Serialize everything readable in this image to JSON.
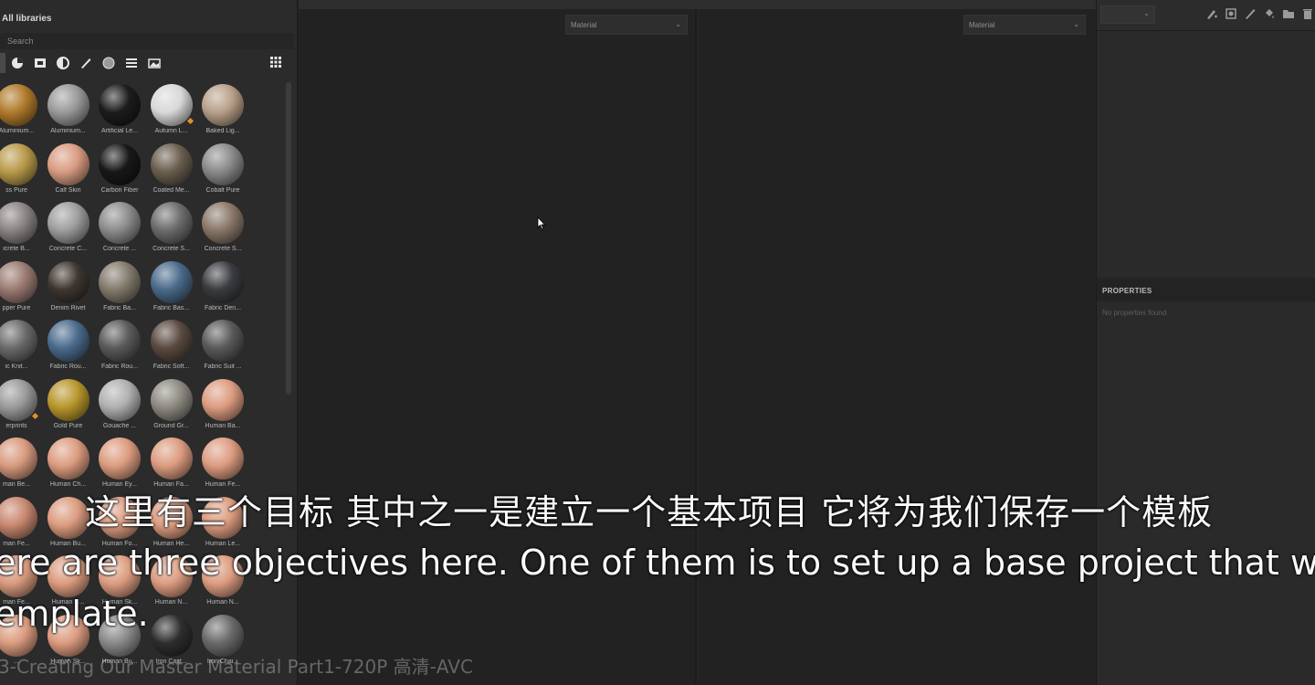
{
  "library": {
    "title": "All libraries",
    "search_placeholder": "Search",
    "filter_icons": [
      "all-filter",
      "material-filter",
      "square-filter",
      "smart-filter",
      "brush-filter",
      "texture-filter",
      "pattern-filter",
      "scene-filter"
    ],
    "rows": [
      [
        {
          "label": "Aluminium...",
          "color": "#b07a2c"
        },
        {
          "label": "Aluminium...",
          "color": "#9a9a9a"
        },
        {
          "label": "Artificial Le...",
          "color": "#1c1c1c"
        },
        {
          "label": "Autumn L...",
          "color": "#d8d8d8",
          "badge": true
        },
        {
          "label": "Baked Lig...",
          "color": "#b8a08a"
        }
      ],
      [
        {
          "label": "ss Pure",
          "color": "#b89a4a"
        },
        {
          "label": "Calf Skin",
          "color": "#d89c82"
        },
        {
          "label": "Carbon Fiber",
          "color": "#181818"
        },
        {
          "label": "Coated Me...",
          "color": "#6a5e4e"
        },
        {
          "label": "Cobalt Pure",
          "color": "#8a8a8a"
        }
      ],
      [
        {
          "label": "icrete B...",
          "color": "#8a8482"
        },
        {
          "label": "Concrete C...",
          "color": "#9e9e9e"
        },
        {
          "label": "Concrete ...",
          "color": "#8c8c8c"
        },
        {
          "label": "Concrete S...",
          "color": "#6c6c6c"
        },
        {
          "label": "Concrete S...",
          "color": "#8a786a"
        }
      ],
      [
        {
          "label": "pper Pure",
          "color": "#9a7a72"
        },
        {
          "label": "Denim Rivet",
          "color": "#3e3630"
        },
        {
          "label": "Fabric Ba...",
          "color": "#827a6c"
        },
        {
          "label": "Fabric Bas...",
          "color": "#4a6a8a"
        },
        {
          "label": "Fabric Den...",
          "color": "#3a3c40"
        }
      ],
      [
        {
          "label": "ic Knit...",
          "color": "#6a6a6a"
        },
        {
          "label": "Fabric Rou...",
          "color": "#4a6a8c"
        },
        {
          "label": "Fabric Rou...",
          "color": "#5a5a5a"
        },
        {
          "label": "Fabric Soft...",
          "color": "#5a4a40"
        },
        {
          "label": "Fabric Suit ...",
          "color": "#5a5a5a"
        }
      ],
      [
        {
          "label": "erprints",
          "color": "#9a9a9a",
          "badge": true
        },
        {
          "label": "Gold Pure",
          "color": "#b8962c"
        },
        {
          "label": "Gouache ...",
          "color": "#b0b0b0"
        },
        {
          "label": "Ground Gr...",
          "color": "#8e8a82"
        },
        {
          "label": "Human Ba...",
          "color": "#dc9c80"
        }
      ],
      [
        {
          "label": "man Be...",
          "color": "#d89a7e"
        },
        {
          "label": "Human Ch...",
          "color": "#dc9c80"
        },
        {
          "label": "Human Ey...",
          "color": "#dc9c80"
        },
        {
          "label": "Human Fa...",
          "color": "#dc9c80"
        },
        {
          "label": "Human Fe...",
          "color": "#dc9c80"
        }
      ],
      [
        {
          "label": "man Fe...",
          "color": "#c88870"
        },
        {
          "label": "Human Bu...",
          "color": "#dc9c80"
        },
        {
          "label": "Human Fo...",
          "color": "#dc9c80"
        },
        {
          "label": "Human He...",
          "color": "#dc9c80"
        },
        {
          "label": "Human Le...",
          "color": "#dc9c80"
        }
      ],
      [
        {
          "label": "man Fe...",
          "color": "#d89a7e"
        },
        {
          "label": "Human N...",
          "color": "#dc9c80"
        },
        {
          "label": "Human Sk...",
          "color": "#dc9c80"
        },
        {
          "label": "Human N...",
          "color": "#dc9c80"
        },
        {
          "label": "Human N...",
          "color": "#dc9c80"
        }
      ],
      [
        {
          "label": "...",
          "color": "#dc9c80"
        },
        {
          "label": "Human Sk...",
          "color": "#dc9c80"
        },
        {
          "label": "Human Bu...",
          "color": "#8a8a8a"
        },
        {
          "label": "Iron Cast...",
          "color": "#2e2e2e"
        },
        {
          "label": "Iron Chai...",
          "color": "#6a6a6a"
        }
      ]
    ]
  },
  "viewport": {
    "left_dropdown": "Material",
    "right_dropdown": "Material"
  },
  "properties": {
    "header": "PROPERTIES",
    "empty_text": "No properties found"
  },
  "subtitles": {
    "chinese": "这里有三个目标 其中之一是建立一个基本项目 它将为我们保存一个模板",
    "english_line1": "ere are three objectives here. One of them is to set up a base project that will sav",
    "english_line2": "emplate.",
    "watermark": "3-Creating Our Master Material Part1-720P 高清-AVC"
  }
}
